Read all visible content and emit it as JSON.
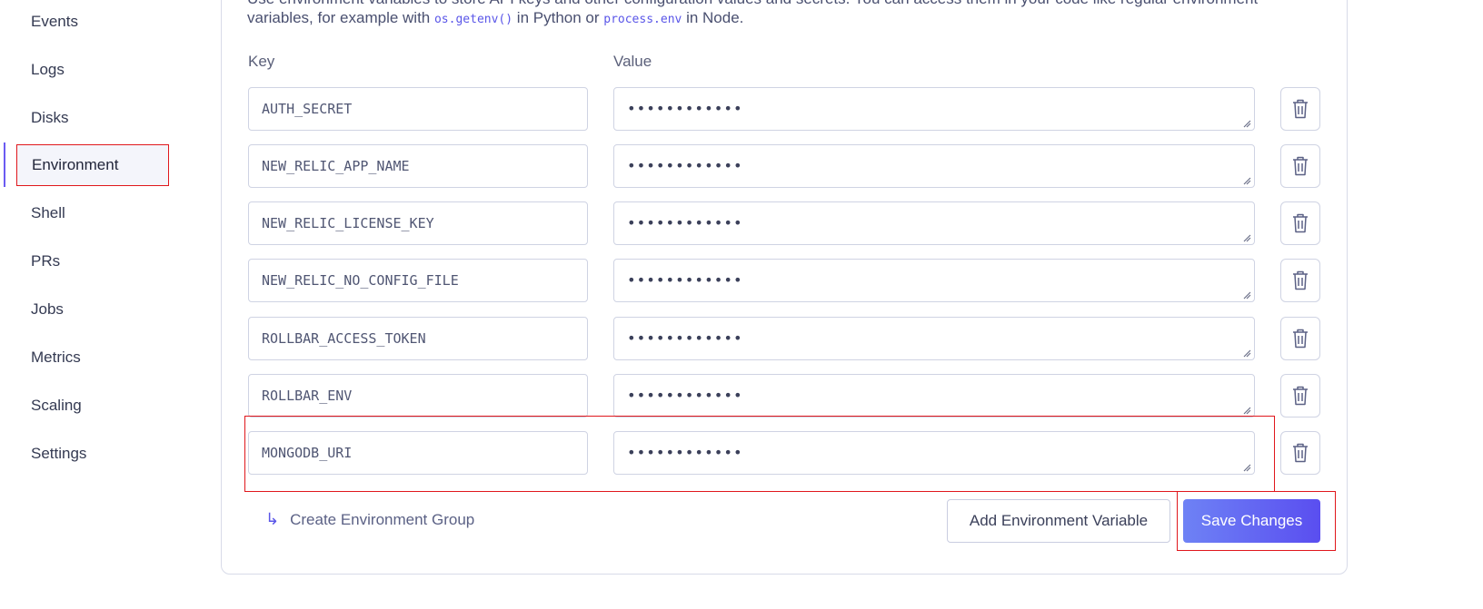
{
  "sidebar": {
    "items": [
      {
        "label": "Events"
      },
      {
        "label": "Logs"
      },
      {
        "label": "Disks"
      },
      {
        "label": "Environment"
      },
      {
        "label": "Shell"
      },
      {
        "label": "PRs"
      },
      {
        "label": "Jobs"
      },
      {
        "label": "Metrics"
      },
      {
        "label": "Scaling"
      },
      {
        "label": "Settings"
      }
    ],
    "active": "Environment"
  },
  "description": {
    "line1": "Use environment variables to store API keys and other configuration values and secrets. You can access them in your code like regular environment",
    "line2_pre": "variables, for example with ",
    "code1": "os.getenv()",
    "line2_mid": " in Python or ",
    "code2": "process.env",
    "line2_post": " in Node."
  },
  "columns": {
    "key": "Key",
    "value": "Value"
  },
  "env_vars": [
    {
      "key": "AUTH_SECRET",
      "value": "••••••••••••"
    },
    {
      "key": "NEW_RELIC_APP_NAME",
      "value": "••••••••••••"
    },
    {
      "key": "NEW_RELIC_LICENSE_KEY",
      "value": "••••••••••••"
    },
    {
      "key": "NEW_RELIC_NO_CONFIG_FILE",
      "value": "••••••••••••"
    },
    {
      "key": "ROLLBAR_ACCESS_TOKEN",
      "value": "••••••••••••"
    },
    {
      "key": "ROLLBAR_ENV",
      "value": "••••••••••••"
    },
    {
      "key": "MONGODB_URI",
      "value": "••••••••••••"
    }
  ],
  "actions": {
    "create_group": "Create Environment Group",
    "add_variable": "Add Environment Variable",
    "save": "Save Changes"
  },
  "icons": {
    "delete": "trash-icon",
    "create_group": "arrow-return-right-icon"
  },
  "colors": {
    "accent": "#5a4ef0",
    "highlight": "#e0171c"
  }
}
